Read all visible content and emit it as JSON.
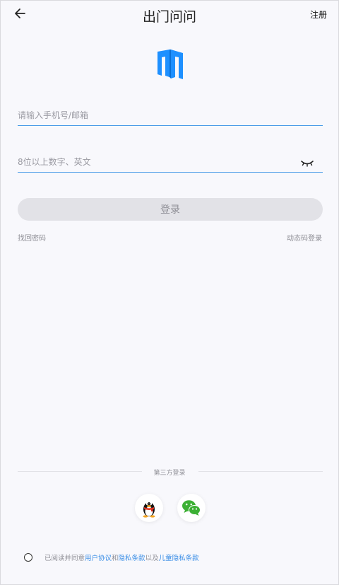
{
  "header": {
    "title": "出门问问",
    "register_label": "注册"
  },
  "form": {
    "account_placeholder": "请输入手机号/邮箱",
    "password_placeholder": "8位以上数字、英文",
    "login_label": "登录",
    "forgot_label": "找回密码",
    "dynamic_login_label": "动态码登录"
  },
  "third_party": {
    "label": "第三方登录",
    "providers": [
      "qq",
      "wechat"
    ]
  },
  "agreement": {
    "prefix": "已阅读并同意",
    "user_agreement": "用户协议",
    "and": "和",
    "privacy_policy": "隐私条款",
    "and2": "以及",
    "children_privacy": "儿童隐私条款"
  },
  "colors": {
    "accent": "#3a8ee6",
    "logo_blue": "#1e90ff",
    "button_bg": "#e2e2e7",
    "background": "#f8f8fc"
  },
  "icons": {
    "back": "back-arrow-icon",
    "password_visibility": "eye-closed-icon",
    "logo": "mobvoi-logo-icon"
  }
}
